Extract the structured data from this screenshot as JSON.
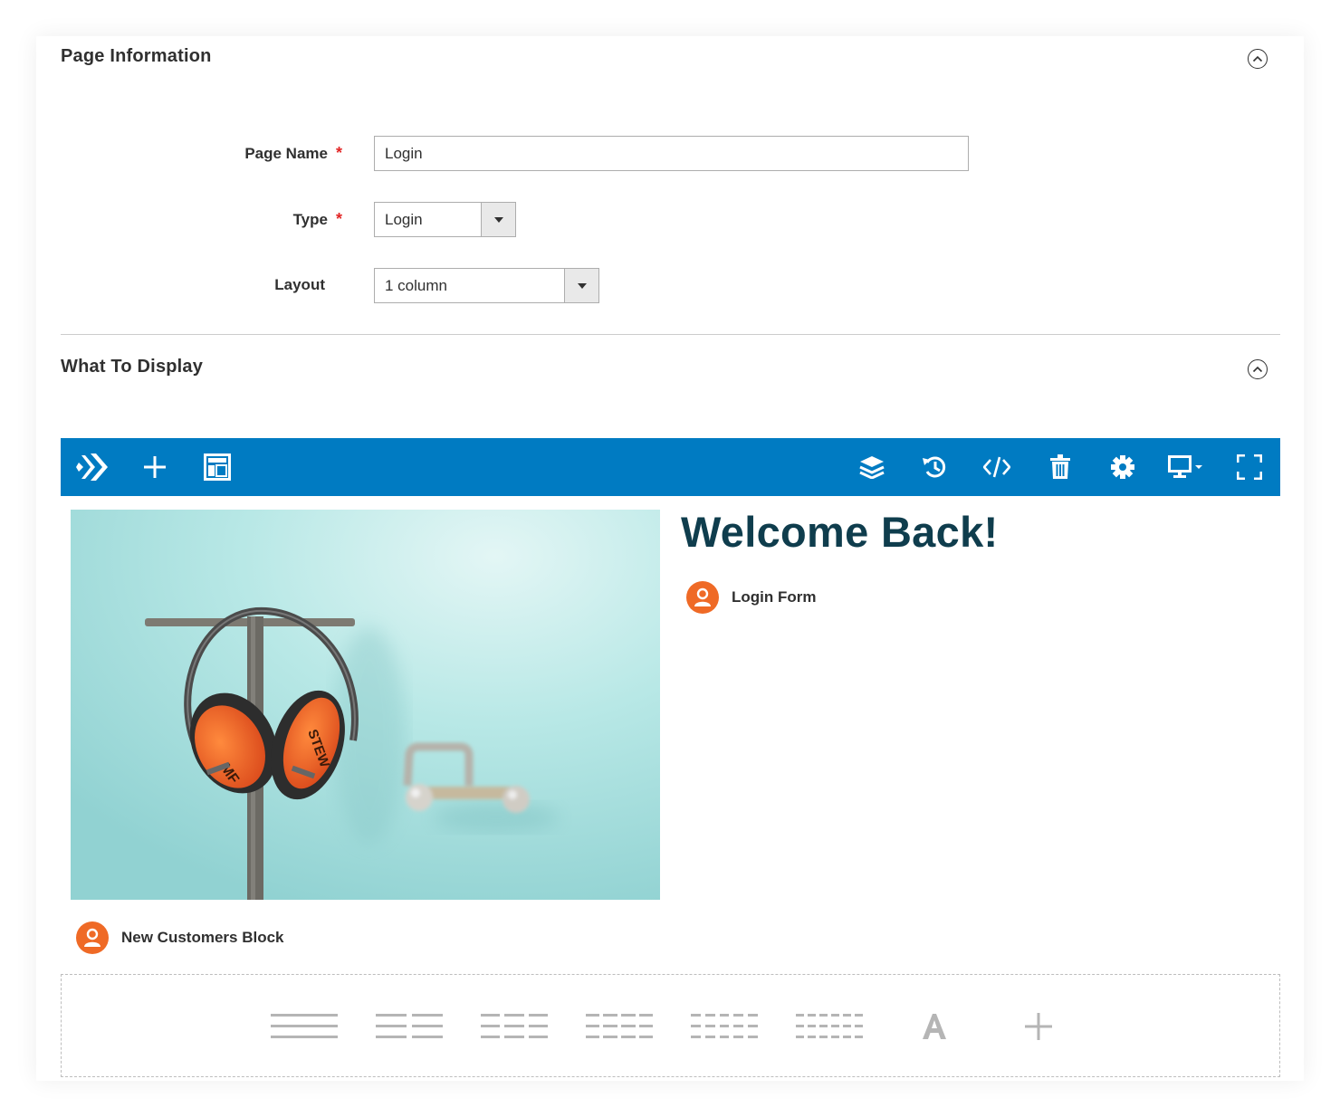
{
  "page_information": {
    "title": "Page Information",
    "fields": {
      "page_name": {
        "label": "Page Name",
        "value": "Login",
        "required": "*"
      },
      "type": {
        "label": "Type",
        "value": "Login",
        "required": "*"
      },
      "layout": {
        "label": "Layout",
        "value": "1 column"
      }
    }
  },
  "what_to_display": {
    "title": "What To Display"
  },
  "builder_toolbar": {
    "accent_color": "#007bc2",
    "left_icons": [
      "logo-icon",
      "plus-icon",
      "layout-icon"
    ],
    "right_icons": [
      "layers-icon",
      "history-icon",
      "code-icon",
      "trash-icon",
      "gear-icon",
      "desktop-device-icon",
      "fullscreen-icon"
    ]
  },
  "content": {
    "heading": "Welcome Back!",
    "login_widget": "Login Form",
    "new_customers_widget": "New Customers Block",
    "widget_icon_color": "#ef6a26"
  },
  "dropzone_icons": [
    "one-column-icon",
    "two-columns-icon",
    "three-columns-icon",
    "four-columns-icon",
    "five-columns-icon",
    "six-columns-icon",
    "text-icon",
    "add-icon"
  ]
}
